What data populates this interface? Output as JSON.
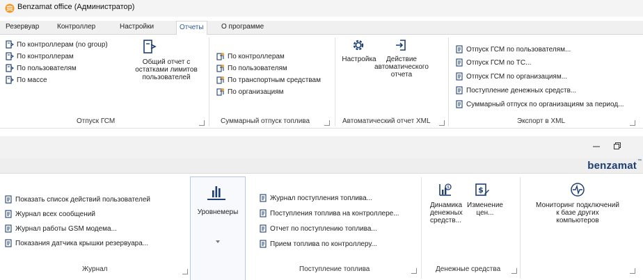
{
  "window": {
    "title": "Benzamat office (Администратор)",
    "brand": "benzamat",
    "brand_tm": "™"
  },
  "menu": {
    "tabs": [
      "Резервуар",
      "Контроллер",
      "Настройки",
      "Отчеты",
      "О программе"
    ],
    "active": "Отчеты"
  },
  "ribbon_top": {
    "groups": [
      {
        "label": "Отпуск ГСМ",
        "items": [
          "По контроллерам (no group)",
          "По контроллерам",
          "По пользователям",
          "По массе"
        ],
        "big": "Общий отчет с\nостатками лимитов\nпользователей"
      },
      {
        "label": "Суммарный отпуск топлива",
        "items": [
          "По контроллерам",
          "По пользователям",
          "По транспортным средствам",
          "По организациям"
        ]
      },
      {
        "label": "Автоматический отчет XML",
        "big": [
          "Настройка",
          "Действие\nавтоматического\nотчета"
        ]
      },
      {
        "label": "Экспорт в XML",
        "items": [
          "Отпуск ГСМ по пользователям...",
          "Отпуск ГСМ по ТС...",
          "Отпуск ГСМ по организациям...",
          "Поступление денежных средств...",
          "Суммарный отпуск по организациям за период..."
        ]
      }
    ]
  },
  "ribbon_bottom": {
    "groups": [
      {
        "label": "Журнал",
        "items": [
          "Показать список действий пользователей",
          "Журнал всех сообщений",
          "Журнал работы GSM модема...",
          "Показания датчика крышки резервуара..."
        ]
      },
      {
        "label": "",
        "big": "Уровнемеры"
      },
      {
        "label": "Поступление топлива",
        "items": [
          "Журнал поступления топлива...",
          "Поступления топлива на контроллере...",
          "Отчет по поступлению топлива...",
          "Прием топлива по контроллеру..."
        ]
      },
      {
        "label": "Денежные средства",
        "big": [
          "Динамика\nденежных\nсредств...",
          "Изменение\nцен..."
        ]
      },
      {
        "label": "",
        "big": "Мониторинг подключений\nк базе других\nкомпьютеров"
      }
    ]
  },
  "icons": {
    "app": "benzamat-flame-icon",
    "report": "report-doc-icon",
    "fuel": "fuel-report-icon",
    "summary": "summary-fuel-icon",
    "settings": "gear-icon",
    "action": "action-import-icon",
    "level": "bar-chart-icon",
    "money": "money-chart-icon",
    "price": "price-change-icon",
    "monitor": "pulse-monitor-icon"
  },
  "colors": {
    "accent": "#2b5797",
    "icon": "#1e3f73",
    "brand": "#1d3d72",
    "flame": "#e86b1a"
  }
}
